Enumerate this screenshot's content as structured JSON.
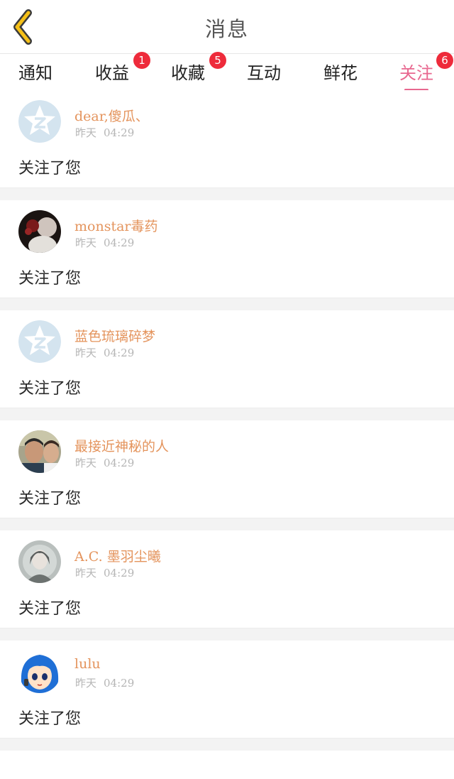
{
  "header": {
    "title": "消息",
    "back_icon": "chevron-left-icon",
    "accent_color": "#f5c018"
  },
  "tabs": [
    {
      "label": "通知",
      "badge": null
    },
    {
      "label": "收益",
      "badge": "1"
    },
    {
      "label": "收藏",
      "badge": "5"
    },
    {
      "label": "互动",
      "badge": null
    },
    {
      "label": "鲜花",
      "badge": null
    },
    {
      "label": "关注",
      "badge": "6",
      "active": true
    }
  ],
  "colors": {
    "active_tab": "#e8678f",
    "badge": "#ee2b3b",
    "username": "#e4945d",
    "time": "#b5b5b5"
  },
  "messages": [
    {
      "username": "dear,傻瓜、",
      "day": "昨天",
      "time": "04:29",
      "text": "关注了您",
      "avatar": "default-qzone-avatar"
    },
    {
      "username": "monstar毒药",
      "day": "昨天",
      "time": "04:29",
      "text": "关注了您",
      "avatar": "photo-avatar"
    },
    {
      "username": "蓝色琉璃碎梦",
      "day": "昨天",
      "time": "04:29",
      "text": "关注了您",
      "avatar": "default-qzone-avatar"
    },
    {
      "username": "最接近神秘的人",
      "day": "昨天",
      "time": "04:29",
      "text": "关注了您",
      "avatar": "photo-avatar"
    },
    {
      "username": "A.C. 墨羽尘曦",
      "day": "昨天",
      "time": "04:29",
      "text": "关注了您",
      "avatar": "photo-avatar"
    },
    {
      "username": "lulu",
      "day": "昨天",
      "time": "04:29",
      "text": "关注了您",
      "avatar": "anime-avatar"
    }
  ]
}
